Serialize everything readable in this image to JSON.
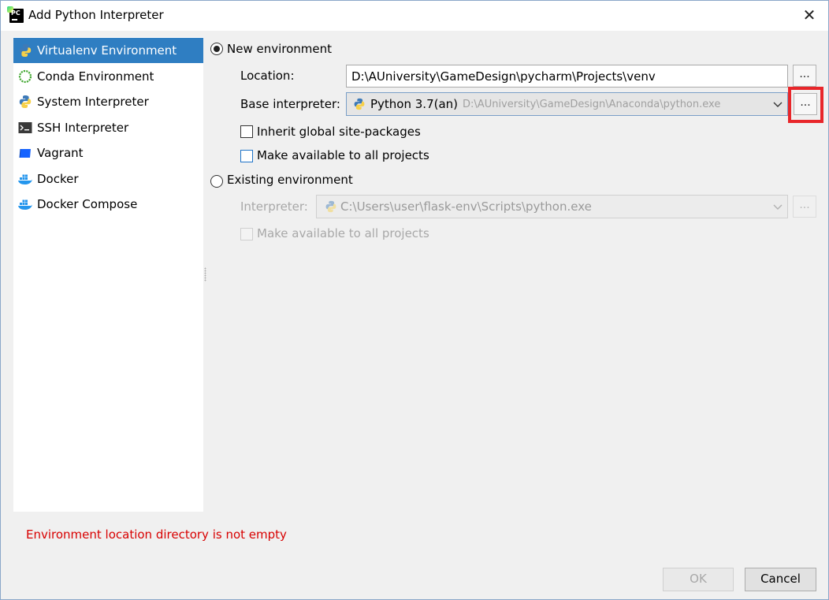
{
  "window": {
    "title": "Add Python Interpreter",
    "app_icon_text": "PC"
  },
  "sidebar": {
    "items": [
      {
        "label": "Virtualenv Environment",
        "icon": "virtualenv-icon",
        "selected": true
      },
      {
        "label": "Conda Environment",
        "icon": "conda-icon",
        "selected": false
      },
      {
        "label": "System Interpreter",
        "icon": "python-icon",
        "selected": false
      },
      {
        "label": "SSH Interpreter",
        "icon": "terminal-icon",
        "selected": false
      },
      {
        "label": "Vagrant",
        "icon": "vagrant-icon",
        "selected": false
      },
      {
        "label": "Docker",
        "icon": "docker-icon",
        "selected": false
      },
      {
        "label": "Docker Compose",
        "icon": "docker-icon",
        "selected": false
      }
    ]
  },
  "new_env": {
    "radio_label": "New environment",
    "selected": true,
    "location_label": "Location:",
    "location_value": "D:\\AUniversity\\GameDesign\\pycharm\\Projects\\venv",
    "base_label": "Base interpreter:",
    "base_name": "Python 3.7(an)",
    "base_path": "D:\\AUniversity\\GameDesign\\Anaconda\\python.exe",
    "browse_label": "...",
    "inherit_label": "Inherit global site-packages",
    "make_available_label": "Make available to all projects"
  },
  "existing_env": {
    "radio_label": "Existing environment",
    "selected": false,
    "interpreter_label": "Interpreter:",
    "interpreter_value": "C:\\Users\\user\\flask-env\\Scripts\\python.exe",
    "browse_label": "...",
    "make_available_label": "Make available to all projects"
  },
  "error": "Environment location directory is not empty",
  "buttons": {
    "ok": "OK",
    "cancel": "Cancel"
  },
  "colors": {
    "selection": "#2f7ec2",
    "error": "#d80000",
    "highlight": "#e8262a"
  }
}
